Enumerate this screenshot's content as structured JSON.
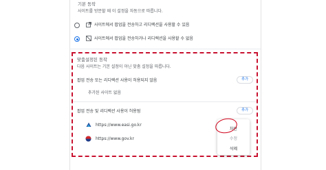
{
  "default_section": {
    "title": "기본 동작",
    "subtitle": "사이트를 방문할 때 이 설정을 자동으로 따릅니다.",
    "options": [
      {
        "label": "사이트에서 팝업을 전송하고 리디렉션을 사용할 수 있음",
        "icon": "external-link-icon",
        "checked": false
      },
      {
        "label": "사이트에서 팝업을 전송하거나 리디렉션을 사용할 수 없음",
        "icon": "popup-blocked-icon",
        "checked": true
      }
    ]
  },
  "custom_section": {
    "title": "맞춤설정된 동작",
    "subtitle": "다음 사이트는 기본 설정이 아닌 맞춤 설정을 따릅니다.",
    "blocked": {
      "label": "팝업 전송 또는 리디렉션 사용이 허용되지 않음",
      "add_label": "추가",
      "empty_label": "추가된 사이트 없음"
    },
    "allowed": {
      "label": "팝업 전송 및 리디렉션 사용이 허용됨",
      "add_label": "추가",
      "sites": [
        {
          "url": "https://www.easi.go.kr",
          "icon": "easi-favicon"
        },
        {
          "url": "https://www.gov.kr",
          "icon": "gov-kr-favicon"
        }
      ]
    }
  },
  "context_menu": {
    "items": [
      "차단",
      "수정",
      "삭제"
    ]
  },
  "colors": {
    "accent": "#1a73e8",
    "annotation_red": "#c8102e"
  }
}
